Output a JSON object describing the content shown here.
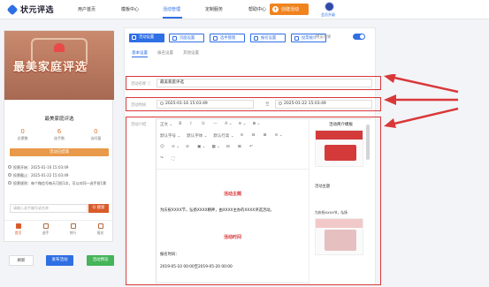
{
  "nav": {
    "brand": "状元评选",
    "items": [
      "用户首页",
      "模板中心",
      "活动管理",
      "定制服务",
      "帮助中心"
    ],
    "create_label": "创建活动",
    "member_label": "会员升级"
  },
  "preview": {
    "banner_text": "最美家庭评选",
    "title": "最美家庭评选",
    "stats": [
      {
        "num": "0",
        "label": "总票数"
      },
      {
        "num": "6",
        "label": "选手数"
      },
      {
        "num": "0",
        "label": "访问量"
      }
    ],
    "countdown": "活动已结束",
    "info": [
      "投票开始：2025-01-16 15:03:49",
      "投票截止：2025-01-22 15:03:49",
      "投票规则：每个微信号每天可投1次，可以对同一选手投1票"
    ],
    "search_placeholder": "请输入选手编号或名称",
    "search_button": "Q 搜索",
    "tabs": [
      "首页",
      "选手",
      "排行",
      "报名"
    ]
  },
  "bottom_buttons": {
    "refresh": "刷新",
    "publish": "发布活动",
    "preview": "活动预览"
  },
  "toolbar": [
    "活动设置",
    "页面设置",
    "选手管理",
    "报名设置",
    "投票统计"
  ],
  "preview_toggle_label": "预览效果",
  "subtabs": [
    "基本设置",
    "报名设置",
    "其他设置"
  ],
  "form": {
    "name_label": "活动名称 ⓘ",
    "name_value": "最美家庭评选",
    "time_label": "活动时间",
    "start": "2025-01-16 15:03:49",
    "sep": "至",
    "end": "2025-01-22 15:03:49",
    "intro_label": "活动介绍"
  },
  "editor": {
    "toolbar_row1": [
      "正文 ⌄",
      "B",
      "I",
      "U",
      "—",
      "A ⌄",
      "≡ ⌄",
      "⊞ ⌄"
    ],
    "toolbar_row2": [
      "默认字号 ⌄",
      "默认字体 ⌄",
      "默认行高 ⌄",
      "≡",
      "⊟",
      "⊞",
      "≡ ⌄"
    ],
    "toolbar_row3": [
      "☺",
      "⊙ ⌄",
      "⊘",
      "▣ ⌄",
      "▦ ⌄",
      "⊟",
      "⊠",
      "↶"
    ],
    "toolbar_row4": [
      "↷",
      "⛶"
    ],
    "heading1": "活动主题",
    "para1": "为庆祝XXXX节，弘扬XXXX精神，由XXXX主办的XXXX评选活动。",
    "heading2": "活动时间",
    "para2": "报名时间：",
    "para3": "2019-05-10 00:00至2019-05-20 00:00"
  },
  "templates": {
    "title": "活动简介模板",
    "label2": "活动主题",
    "card_text": "为庆祝XXXX节，弘扬"
  }
}
